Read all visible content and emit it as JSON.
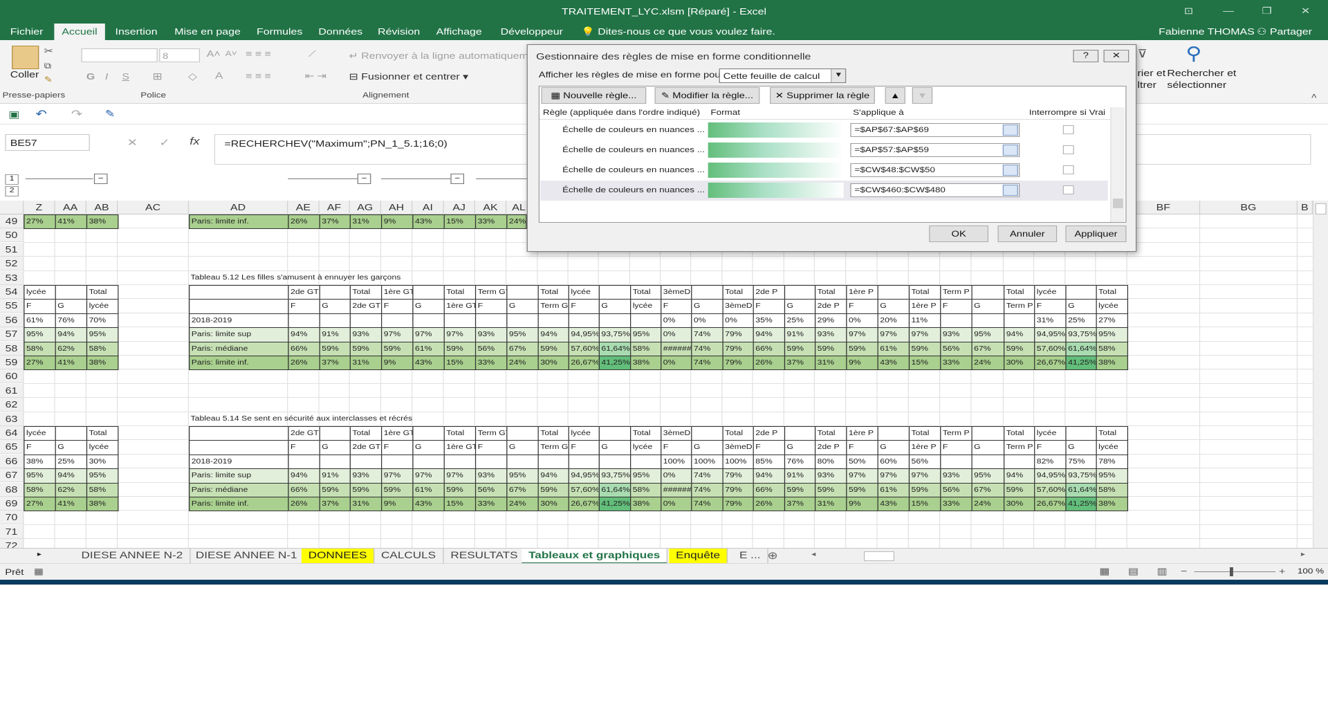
{
  "window": {
    "title": "TRAITEMENT_LYC.xlsm [Réparé] - Excel",
    "user": "Fabienne THOMAS",
    "share": "Partager"
  },
  "ribbon_tabs": [
    "Fichier",
    "Accueil",
    "Insertion",
    "Mise en page",
    "Formules",
    "Données",
    "Révision",
    "Affichage",
    "Développeur",
    "Dites-nous ce que vous voulez faire."
  ],
  "ribbon": {
    "paste": "Coller",
    "clipboard": "Presse-papiers",
    "font_size": "8",
    "police": "Police",
    "wrap": "Renvoyer à la ligne automatiquement",
    "merge": "Fusionner et centrer",
    "alignment": "Alignement",
    "trier": "rier et",
    "filtrer": "ltrer",
    "rechercher": "Rechercher et",
    "selectionner": "sélectionner",
    "bold": "G",
    "italic": "I",
    "underline": "S"
  },
  "formula_bar": {
    "name_box": "BE57",
    "formula": "=RECHERCHEV(\"Maximum\";PN_1_5.1;16;0)"
  },
  "columns": [
    "Z",
    "AA",
    "AB",
    "AC",
    "AD",
    "AE",
    "AF",
    "AG",
    "AH",
    "AI",
    "AJ",
    "AK",
    "AL",
    "BF",
    "BG",
    "B"
  ],
  "rows": [
    "49",
    "50",
    "51",
    "52",
    "53",
    "54",
    "55",
    "56",
    "57",
    "58",
    "59",
    "60",
    "61",
    "62",
    "63",
    "64",
    "65",
    "66",
    "67",
    "68",
    "69",
    "70",
    "71",
    "72"
  ],
  "row49": [
    "27%",
    "41%",
    "38%",
    "Paris: limite inf.",
    "26%",
    "37%",
    "31%",
    "9%",
    "43%",
    "15%",
    "33%",
    "24%"
  ],
  "table1": {
    "title": "Tableau 5.12 Les filles s'amusent à ennuyer les garçons",
    "hdr1": [
      "lycée",
      "",
      "Total",
      "",
      "2de GT",
      "",
      "Total",
      "1ère GT",
      "",
      "Total",
      "Term GT",
      "",
      "Total",
      "lycée",
      "",
      "Total",
      "3èmeDP",
      "",
      "Total",
      "2de P",
      "",
      "Total",
      "1ère P",
      "",
      "Total",
      "Term P",
      "",
      "Total",
      "lycée",
      "",
      "Total"
    ],
    "hdr2": [
      "F",
      "G",
      "lycée",
      "",
      "F",
      "G",
      "2de GT",
      "F",
      "G",
      "1ère GT",
      "F",
      "G",
      "Term GT",
      "F",
      "G",
      "lycée",
      "F",
      "G",
      "3èmeDP",
      "F",
      "G",
      "2de P",
      "F",
      "G",
      "1ère P",
      "F",
      "G",
      "Term P",
      "F",
      "G",
      "lycée"
    ],
    "r56": [
      "61%",
      "76%",
      "70%",
      "2018-2019",
      "",
      "",
      "",
      "",
      "",
      "",
      "",
      "",
      "",
      "",
      "",
      "",
      "0%",
      "0%",
      "0%",
      "35%",
      "25%",
      "29%",
      "0%",
      "20%",
      "11%",
      "",
      "",
      "",
      "31%",
      "25%",
      "27%"
    ],
    "r57": [
      "95%",
      "94%",
      "95%",
      "Paris: limite sup",
      "94%",
      "91%",
      "93%",
      "97%",
      "97%",
      "97%",
      "93%",
      "95%",
      "94%",
      "94,95%",
      "93,75%",
      "95%",
      "0%",
      "74%",
      "79%",
      "94%",
      "91%",
      "93%",
      "97%",
      "97%",
      "97%",
      "93%",
      "95%",
      "94%",
      "94,95%",
      "93,75%",
      "95%"
    ],
    "r58": [
      "58%",
      "62%",
      "58%",
      "Paris: médiane",
      "66%",
      "59%",
      "59%",
      "59%",
      "61%",
      "59%",
      "56%",
      "67%",
      "59%",
      "57,60%",
      "61,64%",
      "58%",
      "######",
      "74%",
      "79%",
      "66%",
      "59%",
      "59%",
      "59%",
      "61%",
      "59%",
      "56%",
      "67%",
      "59%",
      "57,60%",
      "61,64%",
      "58%"
    ],
    "r59": [
      "27%",
      "41%",
      "38%",
      "Paris: limite inf.",
      "26%",
      "37%",
      "31%",
      "9%",
      "43%",
      "15%",
      "33%",
      "24%",
      "30%",
      "26,67%",
      "41,25%",
      "38%",
      "0%",
      "74%",
      "79%",
      "26%",
      "37%",
      "31%",
      "9%",
      "43%",
      "15%",
      "33%",
      "24%",
      "30%",
      "26,67%",
      "41,25%",
      "38%"
    ]
  },
  "table2": {
    "title": "Tableau 5.14 Se sent en sécurité aux interclasses et récrés",
    "r66": [
      "38%",
      "25%",
      "30%",
      "2018-2019",
      "",
      "",
      "",
      "",
      "",
      "",
      "",
      "",
      "",
      "",
      "",
      "",
      "100%",
      "100%",
      "100%",
      "85%",
      "76%",
      "80%",
      "50%",
      "60%",
      "56%",
      "",
      "",
      "",
      "82%",
      "75%",
      "78%"
    ]
  },
  "dialog": {
    "title": "Gestionnaire des règles de mise en forme conditionnelle",
    "help": "?",
    "show_label": "Afficher les règles de mise en forme pour :",
    "show_value": "Cette feuille de calcul",
    "new_rule": "Nouvelle règle...",
    "edit_rule": "Modifier la règle...",
    "delete_rule": "Supprimer la règle",
    "col_rule": "Règle (appliquée dans l'ordre indiqué)",
    "col_format": "Format",
    "col_applies": "S'applique à",
    "col_stop": "Interrompre si Vrai",
    "rules": [
      {
        "name": "Échelle de couleurs en nuances ...",
        "range": "=$AP$67:$AP$69"
      },
      {
        "name": "Échelle de couleurs en nuances ...",
        "range": "=$AP$57:$AP$59"
      },
      {
        "name": "Échelle de couleurs en nuances ...",
        "range": "=$CW$48:$CW$50"
      },
      {
        "name": "Échelle de couleurs en nuances ...",
        "range": "=$CW$460:$CW$480"
      }
    ],
    "ok": "OK",
    "cancel": "Annuler",
    "apply": "Appliquer"
  },
  "sheets": [
    "DIESE ANNEE N-2",
    "DIESE ANNEE N-1",
    "DONNEES",
    "CALCULS",
    "RESULTATS",
    "Tableaux et graphiques",
    "Enquête",
    "E ..."
  ],
  "status": {
    "ready": "Prêt",
    "zoom": "100 %"
  },
  "colors": {
    "excel_green": "#217346",
    "light_green": "#e2efda",
    "mid_green": "#c6e0b4",
    "dark_green": "#a9d08e",
    "scale_green": "#63be7b",
    "yellow_tab": "#ffff00"
  }
}
